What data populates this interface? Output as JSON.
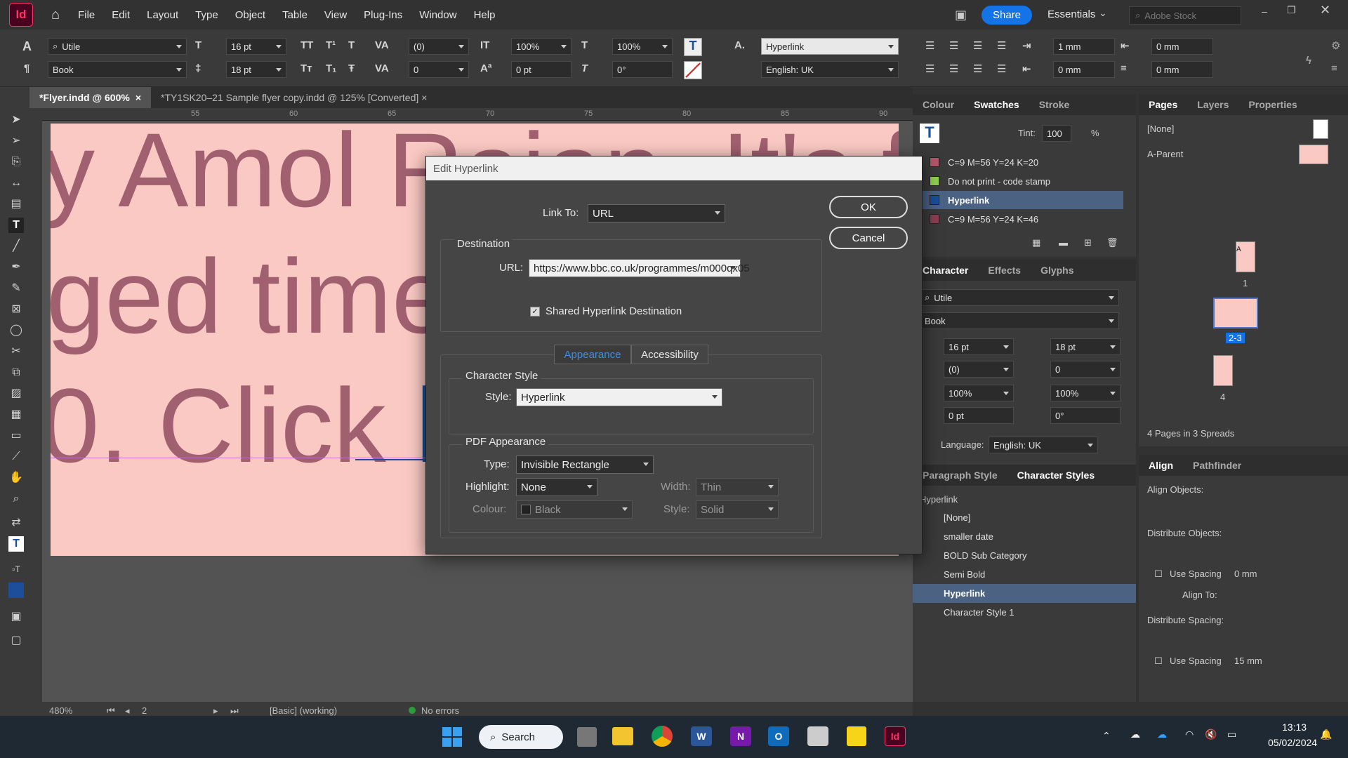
{
  "menubar": {
    "app_logo": "Id",
    "items": [
      "File",
      "Edit",
      "Layout",
      "Type",
      "Object",
      "Table",
      "View",
      "Plug-Ins",
      "Window",
      "Help"
    ],
    "share": "Share",
    "workspace": "Essentials",
    "search_placeholder": "Adobe Stock"
  },
  "control": {
    "font_family": "Utile",
    "font_style": "Book",
    "font_size": "16 pt",
    "leading": "18 pt",
    "kerning": "(0)",
    "tracking": "0",
    "vscale": "100%",
    "hscale": "100%",
    "baseline": "0 pt",
    "skew": "0°",
    "char_style": "Hyperlink",
    "language": "English: UK",
    "indent_left": "1 mm",
    "indent_right": "0 mm",
    "space_before": "0 mm",
    "space_after": "0 mm"
  },
  "tabs": [
    {
      "label": "*Flyer.indd @ 600%",
      "close": "×"
    },
    {
      "label": "*TY1SK20–21 Sample flyer copy.indd @ 125% [Converted]",
      "close": "×"
    }
  ],
  "ruler": [
    "55",
    "60",
    "65",
    "70",
    "75",
    "80",
    "85",
    "90"
  ],
  "page_text": [
    "y Amol Rajan. It's fo",
    "ged time",
    "0. Click ",
    "he"
  ],
  "status": {
    "zoom": "480%",
    "page": "2",
    "mode": "[Basic] (working)",
    "errors": "No errors"
  },
  "swatches": {
    "tabs": [
      "Colour",
      "Swatches",
      "Stroke"
    ],
    "tint_label": "Tint:",
    "tint": "100",
    "pct": "%",
    "items": [
      {
        "name": "C=9 M=56 Y=24 K=20",
        "color": "#b3566a"
      },
      {
        "name": "Do not print - code stamp",
        "color": "#8fd14f"
      },
      {
        "name": "Hyperlink",
        "color": "#1b4e9b"
      },
      {
        "name": "C=9 M=56 Y=24 K=46",
        "color": "#8a3f52"
      }
    ]
  },
  "character": {
    "tabs": [
      "Character",
      "Effects",
      "Glyphs"
    ],
    "font": "Utile",
    "style": "Book",
    "size": "16 pt",
    "leading": "18 pt",
    "kerning": "(0)",
    "tracking": "0",
    "vscale": "100%",
    "hscale": "100%",
    "baseline": "0 pt",
    "skew": "0°",
    "language_label": "Language:",
    "language": "English: UK"
  },
  "char_styles": {
    "tabs": [
      "Paragraph Style",
      "Character Styles"
    ],
    "current": "Hyperlink",
    "items": [
      "[None]",
      "smaller date",
      "BOLD Sub Category",
      "Semi Bold",
      "Hyperlink",
      "Character Style 1"
    ],
    "selected": 4
  },
  "pages": {
    "tabs": [
      "Pages",
      "Layers",
      "Properties"
    ],
    "none": "[None]",
    "parent": "A-Parent",
    "p1": "1",
    "p23": "2-3",
    "p4": "4",
    "footer": "4 Pages in 3 Spreads",
    "letter": "A"
  },
  "align": {
    "tabs": [
      "Align",
      "Pathfinder"
    ],
    "align_objects": "Align Objects:",
    "distribute_objects": "Distribute Objects:",
    "use_spacing": "Use Spacing",
    "spacing1": "0 mm",
    "align_to": "Align To:",
    "distribute_spacing": "Distribute Spacing:",
    "spacing2": "15 mm"
  },
  "dialog": {
    "title": "Edit Hyperlink",
    "link_to_label": "Link To:",
    "link_to": "URL",
    "ok": "OK",
    "cancel": "Cancel",
    "destination": "Destination",
    "url_label": "URL:",
    "url": "https://www.bbc.co.uk/programmes/m000qx05",
    "shared": "Shared Hyperlink Destination",
    "tab_appearance": "Appearance",
    "tab_accessibility": "Accessibility",
    "char_style_group": "Character Style",
    "style_label": "Style:",
    "style": "Hyperlink",
    "pdf_group": "PDF Appearance",
    "type_label": "Type:",
    "type": "Invisible Rectangle",
    "highlight_label": "Highlight:",
    "highlight": "None",
    "width_label": "Width:",
    "width": "Thin",
    "colour_label": "Colour:",
    "colour": "Black",
    "style2_label": "Style:",
    "style2": "Solid"
  },
  "taskbar": {
    "search": "Search",
    "time": "13:13",
    "date": "05/02/2024"
  }
}
